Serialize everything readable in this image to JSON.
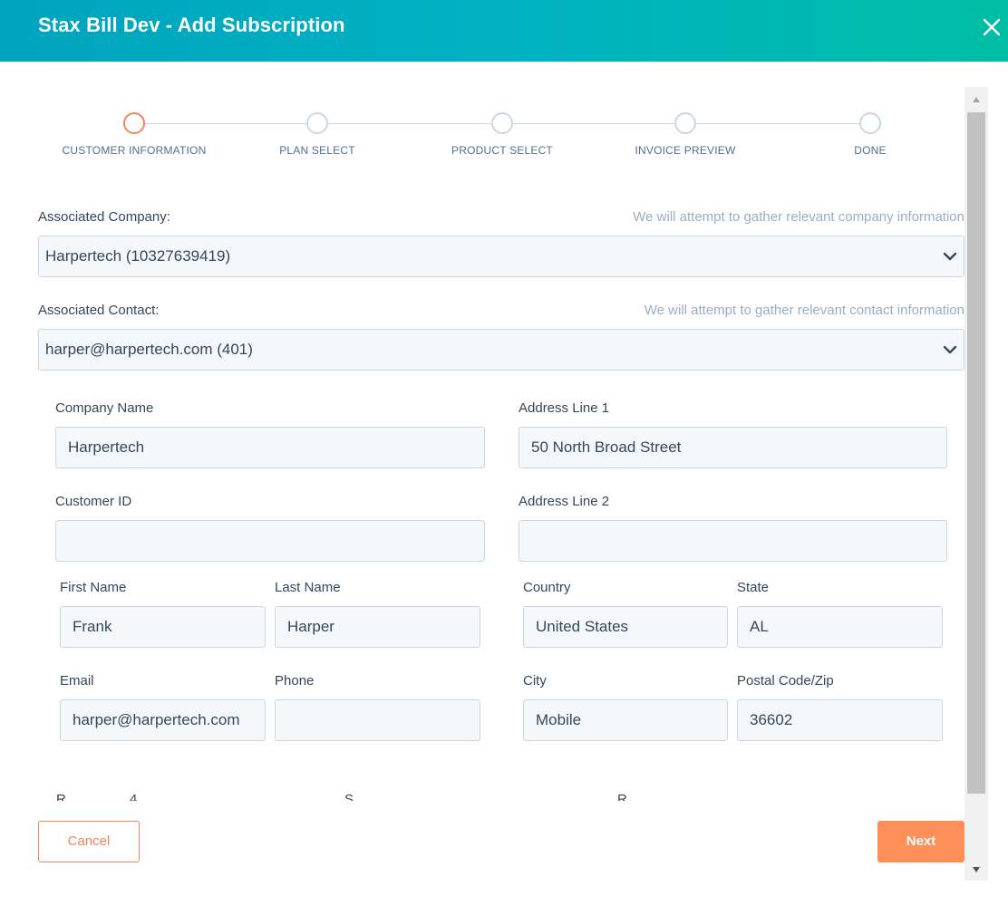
{
  "header": {
    "title": "Stax Bill Dev - Add Subscription",
    "close_icon": "close-icon"
  },
  "stepper": {
    "steps": [
      {
        "label": "CUSTOMER INFORMATION",
        "state": "active"
      },
      {
        "label": "PLAN SELECT",
        "state": "inactive"
      },
      {
        "label": "PRODUCT SELECT",
        "state": "inactive"
      },
      {
        "label": "INVOICE PREVIEW",
        "state": "inactive"
      },
      {
        "label": "DONE",
        "state": "inactive"
      }
    ]
  },
  "company": {
    "label": "Associated Company:",
    "hint": "We will attempt to gather relevant company information",
    "value": "Harpertech (10327639419)"
  },
  "contact": {
    "label": "Associated Contact:",
    "hint": "We will attempt to gather relevant contact information",
    "value": "harper@harpertech.com (401)"
  },
  "form": {
    "company_name": {
      "label": "Company Name",
      "value": "Harpertech"
    },
    "customer_id": {
      "label": "Customer ID",
      "value": ""
    },
    "first_name": {
      "label": "First Name",
      "value": "Frank"
    },
    "last_name": {
      "label": "Last Name",
      "value": "Harper"
    },
    "email": {
      "label": "Email",
      "value": "harper@harpertech.com"
    },
    "phone": {
      "label": "Phone",
      "value": ""
    },
    "address_line_1": {
      "label": "Address Line 1",
      "value": "50 North Broad Street"
    },
    "address_line_2": {
      "label": "Address Line 2",
      "value": ""
    },
    "country": {
      "label": "Country",
      "value": "United States"
    },
    "state": {
      "label": "State",
      "value": "AL"
    },
    "city": {
      "label": "City",
      "value": "Mobile"
    },
    "postal_code": {
      "label": "Postal Code/Zip",
      "value": "36602"
    }
  },
  "footer": {
    "cancel_label": "Cancel",
    "next_label": "Next"
  },
  "colors": {
    "header_gradient_start": "#00a4bd",
    "header_gradient_end": "#00bda5",
    "accent": "#f2845c",
    "next_button": "#ff8f59"
  }
}
